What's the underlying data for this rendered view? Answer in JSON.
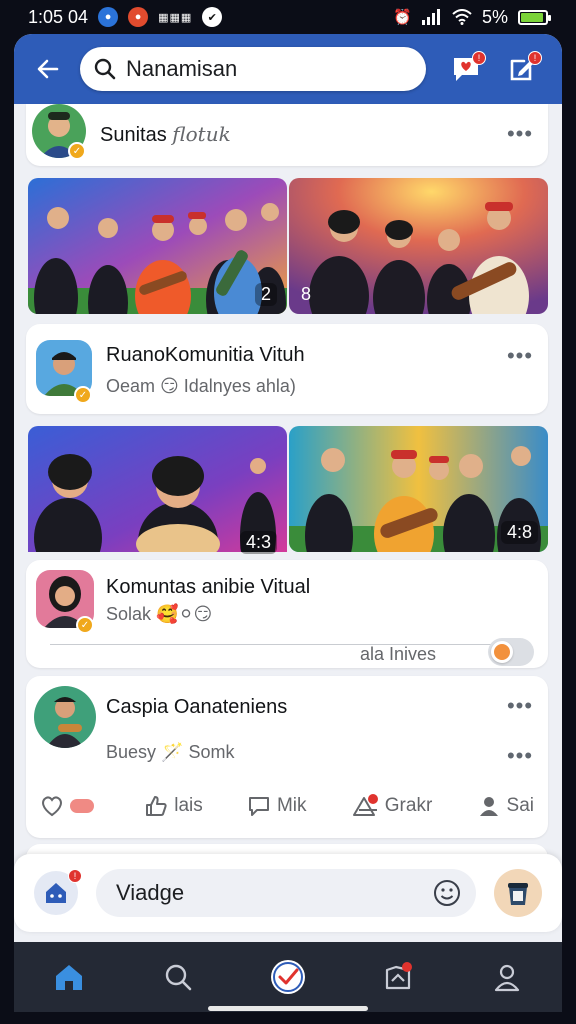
{
  "status_bar": {
    "time": "1:05 04",
    "battery_text": "5%",
    "battery_level": 0.9
  },
  "header": {
    "search_value": "Nanamisan",
    "colors": {
      "bar": "#2e5cb8",
      "badge": "#e0332e"
    }
  },
  "posts": [
    {
      "title": "Sunitas",
      "title_suffix": "flotuk",
      "photos": [
        {
          "badge": "2"
        },
        {
          "badge": "8"
        }
      ]
    },
    {
      "title": "RuanoKomunitia Vituh",
      "subtitle": "Oeam 😏 Idalnyes ahla)",
      "photos": [
        {
          "badge": "4:3"
        },
        {
          "badge": "4:8"
        }
      ]
    },
    {
      "title": "Komuntas anibie Vitual",
      "subtitle": "Solak 🥰⚪😏",
      "footer_label": "ala Inives"
    },
    {
      "title": "Caspia Oanateniens",
      "subtitle": "Buesy 🪄 Somk"
    }
  ],
  "actions": [
    {
      "label": "",
      "icon": "heart-icon"
    },
    {
      "label": "lais",
      "icon": "like-icon"
    },
    {
      "label": "Mik",
      "icon": "comment-icon"
    },
    {
      "label": "Grakr",
      "icon": "share-icon"
    },
    {
      "label": "Sai",
      "icon": "person-icon"
    }
  ],
  "composer": {
    "value": "Viadge"
  },
  "nav": [
    {
      "icon": "home-icon"
    },
    {
      "icon": "search-icon"
    },
    {
      "icon": "check-icon"
    },
    {
      "icon": "notification-icon"
    },
    {
      "icon": "profile-icon"
    }
  ]
}
